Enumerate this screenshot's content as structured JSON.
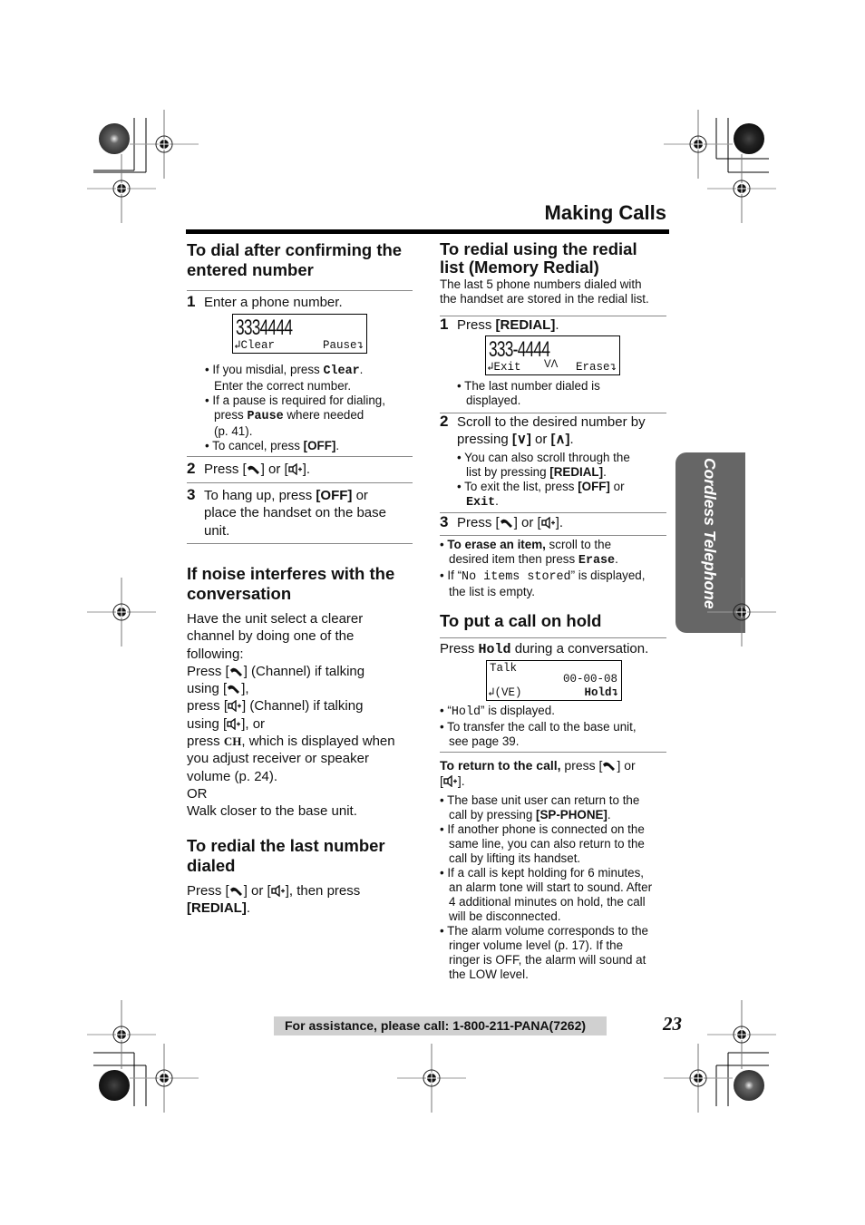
{
  "page": {
    "title": "Making Calls",
    "side_tab": "Cordless Telephone",
    "footer": "For assistance, please call: 1-800-211-PANA(7262)",
    "page_number": "23"
  },
  "left": {
    "dial_confirm": {
      "heading_line1": "To dial after confirming the",
      "heading_line2": "entered number",
      "step1": {
        "num": "1",
        "text": "Enter a phone number."
      },
      "lcd1": {
        "number": "3334444",
        "soft_left": "Clear",
        "soft_right": "Pause"
      },
      "bullets": [
        {
          "pre": "If you misdial, press ",
          "code": "Clear",
          "post": ".",
          "line2": "Enter the correct number."
        },
        {
          "pre": "If a pause is required for dialing,",
          "line2_pre": "press ",
          "code": "Pause",
          "line2_post": " where needed",
          "line3": "(p. 41)."
        },
        {
          "pre": "To cancel, press ",
          "key": "[OFF]",
          "post": "."
        }
      ],
      "step2": {
        "num": "2",
        "pre": "Press [",
        "mid": "] or [",
        "post": "]."
      },
      "step3": {
        "num": "3",
        "line1_pre": "To hang up, press ",
        "key": "[OFF]",
        "line1_post": " or",
        "line2": "place the handset on the base",
        "line3": "unit."
      }
    },
    "noise": {
      "heading_line1": "If noise interferes with the",
      "heading_line2": "conversation",
      "lines": {
        "l1": "Have the unit select a clearer",
        "l2": "channel by doing one of the",
        "l3": "following:",
        "l4_pre": "Press [",
        "l4_post": "] (Channel) if talking",
        "l5_pre": "using [",
        "l5_post": "],",
        "l6_pre": "press [",
        "l6_post": "] (Channel) if talking",
        "l7_pre": "using [",
        "l7_post": "], or",
        "l8_pre": "press ",
        "l8_code": "CH",
        "l8_post": ", which is displayed when",
        "l9": "you adjust receiver or speaker",
        "l10": "volume (p. 24).",
        "l11": "OR",
        "l12": "Walk closer to the base unit."
      }
    },
    "redial_last": {
      "heading_line1": "To redial the last number",
      "heading_line2": "dialed",
      "l1_pre": "Press [",
      "l1_mid": "] or [",
      "l1_post": "], then press",
      "l2_key": "[REDIAL]",
      "l2_post": "."
    }
  },
  "right": {
    "memory_redial": {
      "heading_line1": "To redial using the redial",
      "heading_line2": "list (Memory Redial)",
      "intro1": "The last 5 phone numbers dialed with",
      "intro2": "the handset are stored in the redial list.",
      "step1": {
        "num": "1",
        "pre": "Press ",
        "key": "[REDIAL]",
        "post": "."
      },
      "lcd": {
        "number": "333-4444",
        "soft_left": "Exit",
        "arrows": "VΛ",
        "soft_right": "Erase"
      },
      "step1_bullet1": "The last number dialed is",
      "step1_bullet2": "displayed.",
      "step2": {
        "num": "2",
        "line1": "Scroll to the desired number by",
        "line2_pre": "pressing ",
        "key1": "[∨]",
        "mid": " or ",
        "key2": "[∧]",
        "post": "."
      },
      "step2_bullets": {
        "b1_l1": "You can also scroll through the",
        "b1_l2_pre": "list by pressing ",
        "b1_key": "[REDIAL]",
        "b1_post": ".",
        "b2_l1_pre": "To exit the list, press ",
        "b2_key": "[OFF]",
        "b2_l1_post": " or",
        "b2_code": "Exit",
        "b2_post": "."
      },
      "step3": {
        "num": "3",
        "pre": "Press [",
        "mid": "] or [",
        "post": "]."
      },
      "notes": {
        "n1_bold": "To erase an item,",
        "n1_post": " scroll to the",
        "n1_l2_pre": "desired item then press ",
        "n1_code": "Erase",
        "n1_l2_post": ".",
        "n2_pre": "If “",
        "n2_code": "No items stored",
        "n2_post": "” is displayed,",
        "n2_l2": "the list is empty."
      }
    },
    "hold": {
      "heading": "To put a call on hold",
      "press_pre": "Press ",
      "press_code": "Hold",
      "press_post": " during a conversation.",
      "lcd": {
        "line1": "Talk",
        "timer": "00-00-08",
        "soft_left": "(VE)",
        "soft_right": "Hold"
      },
      "b1_pre": "“",
      "b1_code": "Hold",
      "b1_post": "” is displayed.",
      "b2_l1": "To transfer the call to the base unit,",
      "b2_l2": "see page 39.",
      "return_bold": "To return to the call,",
      "return_pre": " press [",
      "return_mid": "] or",
      "return_l2_pre": "[",
      "return_l2_post": "].",
      "return_bullets": [
        [
          "The base unit user can return to the",
          "call by pressing [SP-PHONE]."
        ],
        [
          "If another phone is connected on the",
          "same line, you can also return to the",
          "call by lifting its handset."
        ],
        [
          "If a call is kept holding for 6 minutes,",
          "an alarm tone will start to sound. After",
          "4 additional minutes on hold, the call",
          "will be disconnected."
        ],
        [
          "The alarm volume corresponds to the",
          "ringer volume level (p. 17). If the",
          "ringer is OFF, the alarm will sound at",
          "the LOW level."
        ]
      ]
    }
  }
}
